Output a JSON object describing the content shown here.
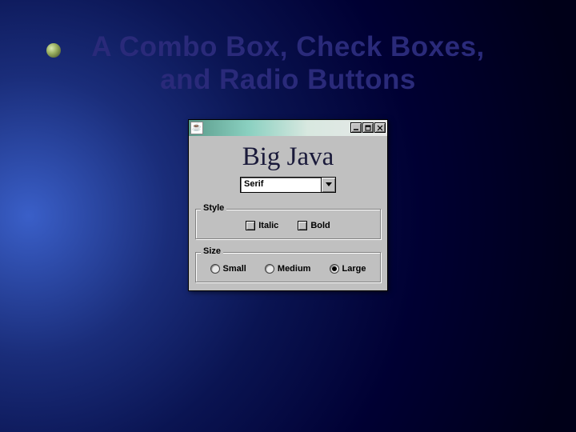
{
  "slide": {
    "title_line1": "A Combo Box, Check Boxes,",
    "title_line2": "and Radio Buttons"
  },
  "window": {
    "display_text": "Big Java",
    "combo": {
      "selected": "Serif"
    },
    "style": {
      "label": "Style",
      "italic": "Italic",
      "bold": "Bold"
    },
    "size": {
      "label": "Size",
      "small": "Small",
      "medium": "Medium",
      "large": "Large",
      "selected": "large"
    }
  }
}
